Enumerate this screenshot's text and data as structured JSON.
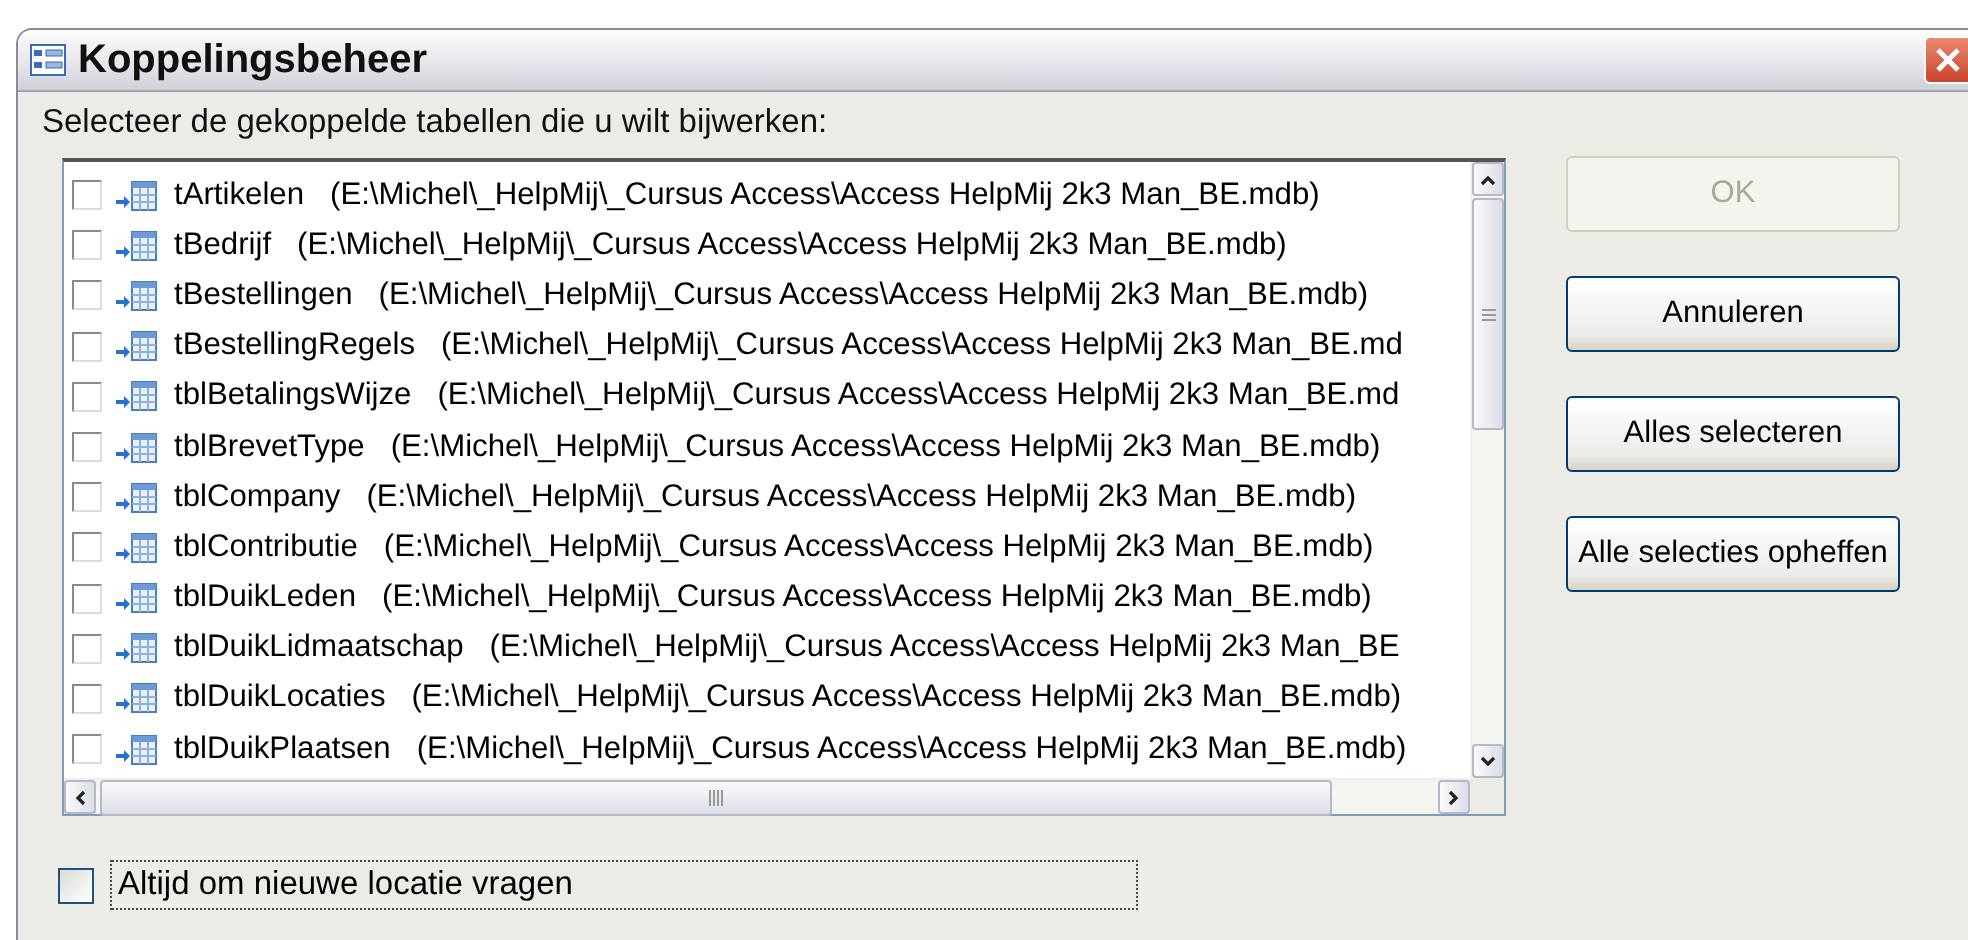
{
  "window": {
    "title": "Koppelingsbeheer"
  },
  "prompt": "Selecteer de gekoppelde tabellen die u wilt bijwerken:",
  "tables": [
    {
      "label": "tArtikelen   (E:\\Michel\\_HelpMij\\_Cursus Access\\Access HelpMij 2k3 Man_BE.mdb)",
      "checked": false
    },
    {
      "label": "tBedrijf   (E:\\Michel\\_HelpMij\\_Cursus Access\\Access HelpMij 2k3 Man_BE.mdb)",
      "checked": false
    },
    {
      "label": "tBestellingen   (E:\\Michel\\_HelpMij\\_Cursus Access\\Access HelpMij 2k3 Man_BE.mdb)",
      "checked": false
    },
    {
      "label": "tBestellingRegels   (E:\\Michel\\_HelpMij\\_Cursus Access\\Access HelpMij 2k3 Man_BE.md",
      "checked": false
    },
    {
      "label": "tblBetalingsWijze   (E:\\Michel\\_HelpMij\\_Cursus Access\\Access HelpMij 2k3 Man_BE.md",
      "checked": false
    },
    {
      "label": "tblBrevetType   (E:\\Michel\\_HelpMij\\_Cursus Access\\Access HelpMij 2k3 Man_BE.mdb)",
      "checked": false
    },
    {
      "label": "tblCompany   (E:\\Michel\\_HelpMij\\_Cursus Access\\Access HelpMij 2k3 Man_BE.mdb)",
      "checked": false
    },
    {
      "label": "tblContributie   (E:\\Michel\\_HelpMij\\_Cursus Access\\Access HelpMij 2k3 Man_BE.mdb)",
      "checked": false
    },
    {
      "label": "tblDuikLeden   (E:\\Michel\\_HelpMij\\_Cursus Access\\Access HelpMij 2k3 Man_BE.mdb)",
      "checked": false
    },
    {
      "label": "tblDuikLidmaatschap   (E:\\Michel\\_HelpMij\\_Cursus Access\\Access HelpMij 2k3 Man_BE",
      "checked": false
    },
    {
      "label": "tblDuikLocaties   (E:\\Michel\\_HelpMij\\_Cursus Access\\Access HelpMij 2k3 Man_BE.mdb)",
      "checked": false
    },
    {
      "label": "tblDuikPlaatsen   (E:\\Michel\\_HelpMij\\_Cursus Access\\Access HelpMij 2k3 Man_BE.mdb)",
      "checked": false
    }
  ],
  "buttons": [
    {
      "label": "OK",
      "disabled": true
    },
    {
      "label": "Annuleren",
      "disabled": false
    },
    {
      "label": "Alles selecteren",
      "disabled": false
    },
    {
      "label": "Alle selecties opheffen",
      "disabled": false
    }
  ],
  "ask_new_location": {
    "label": "Altijd om nieuwe locatie vragen",
    "checked": false
  }
}
